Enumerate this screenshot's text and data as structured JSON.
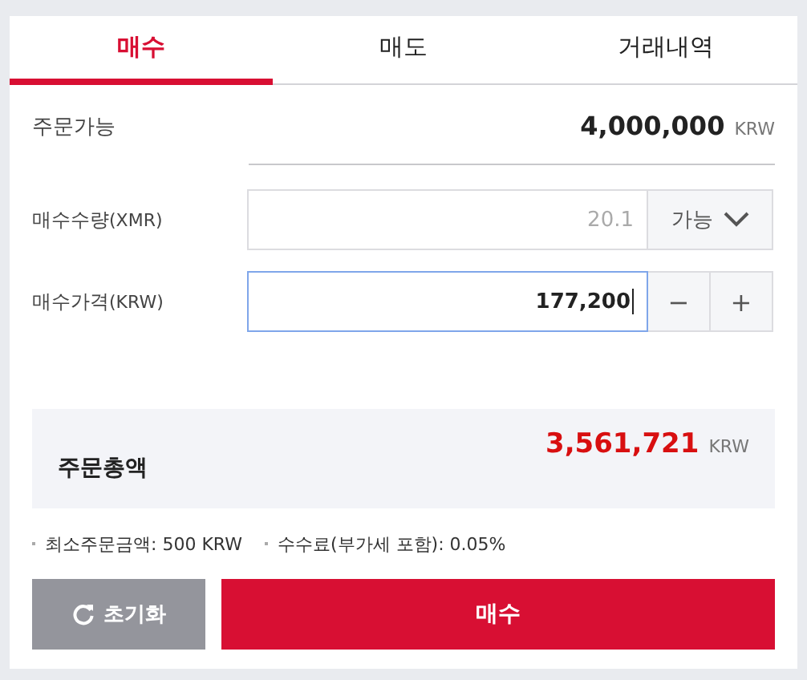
{
  "tabs": [
    {
      "label": "매수",
      "selected": true
    },
    {
      "label": "매도",
      "selected": false
    },
    {
      "label": "거래내역",
      "selected": false
    }
  ],
  "available": {
    "label": "주문가능",
    "value": "4,000,000",
    "unit": "KRW"
  },
  "fields": [
    {
      "kind": "dropdown",
      "label": "매수수량",
      "unit": "(XMR)",
      "value": "20.1",
      "focused": false,
      "control": "가능"
    },
    {
      "kind": "stepper",
      "label": "매수가격",
      "unit": "(KRW)",
      "value": "177,200",
      "focused": true,
      "minus": "−",
      "plus": "+"
    }
  ],
  "total": {
    "label": "주문총액",
    "value": "3,561,721",
    "unit": "KRW"
  },
  "notes": [
    "최소주문금액: 500 KRW",
    "수수료(부가세 포함): 0.05%"
  ],
  "buttons": {
    "reset": "초기화",
    "submit": "매수"
  }
}
